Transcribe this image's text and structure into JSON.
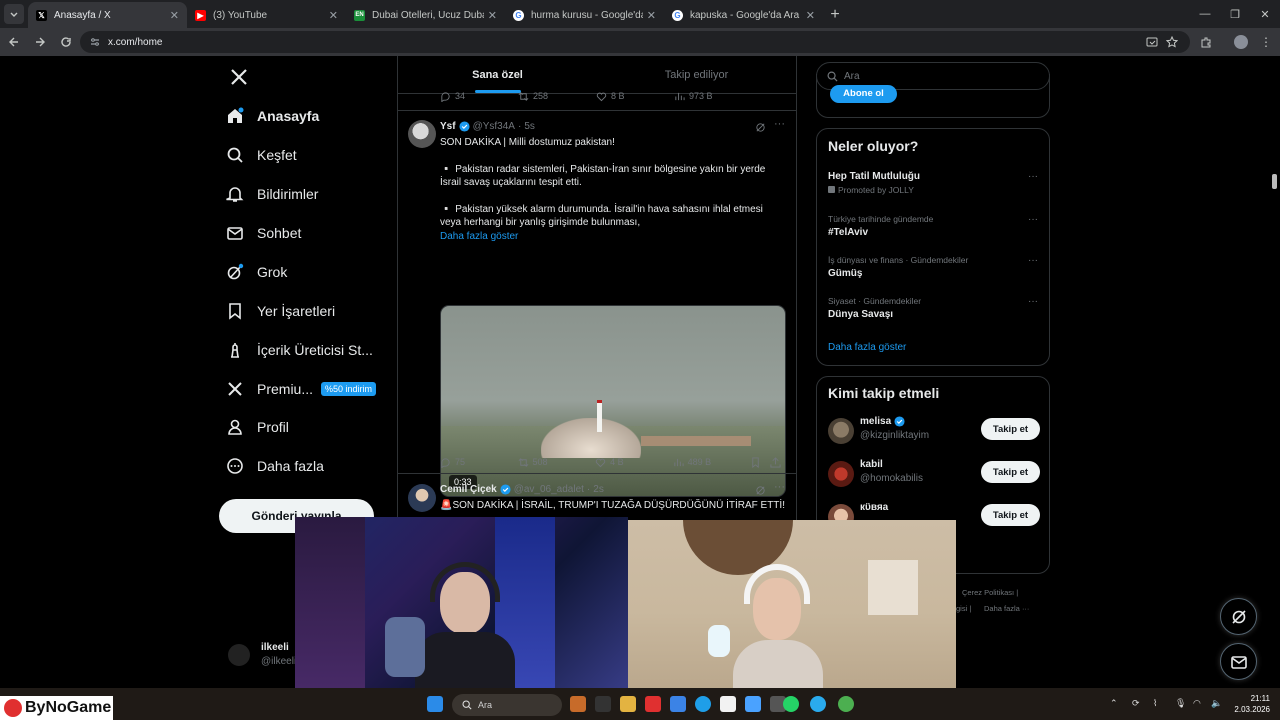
{
  "browser": {
    "tabs": [
      {
        "title": "Anasayfa / X",
        "favicon": "x-logo",
        "active": true
      },
      {
        "title": "(3) YouTube",
        "favicon": "youtube-logo",
        "active": false
      },
      {
        "title": "Dubai Otelleri, Ucuz Dubai Otel",
        "favicon": "hotel-logo",
        "active": false
      },
      {
        "title": "hurma kurusu - Google'da Ara",
        "favicon": "google-logo",
        "active": false
      },
      {
        "title": "kapuska - Google'da Ara",
        "favicon": "google-logo",
        "active": false
      }
    ],
    "url": "x.com/home"
  },
  "nav": {
    "items": [
      {
        "label": "Anasayfa",
        "icon": "home-icon"
      },
      {
        "label": "Keşfet",
        "icon": "search-icon"
      },
      {
        "label": "Bildirimler",
        "icon": "bell-icon"
      },
      {
        "label": "Sohbet",
        "icon": "mail-icon"
      },
      {
        "label": "Grok",
        "icon": "grok-icon"
      },
      {
        "label": "Yer İşaretleri",
        "icon": "bookmark-icon"
      },
      {
        "label": "İçerik Üreticisi St...",
        "icon": "creator-icon"
      },
      {
        "label": "Premiu...",
        "icon": "x-icon"
      },
      {
        "label": "Profil",
        "icon": "person-icon"
      },
      {
        "label": "Daha fazla",
        "icon": "more-circle-icon"
      }
    ],
    "premium_badge": "%50 indirim",
    "post_button": "Gönderi yayınla",
    "account": {
      "name": "ilkeeli",
      "handle": "@ilkeeli"
    }
  },
  "feed": {
    "tabs": [
      "Sana özel",
      "Takip ediliyor"
    ],
    "prev_actions": {
      "replies": "34",
      "reposts": "258",
      "likes": "8 B",
      "views": "973 B"
    },
    "tweet1": {
      "name": "Ysf",
      "handle": "@Ysf34A",
      "time": "5s",
      "headline": "SON DAKİKA | Milli dostumuz pakistan!",
      "bullet1": "Pakistan radar sistemleri, Pakistan-İran sınır bölgesine yakın bir yerde İsrail savaş uçaklarını tespit etti.",
      "bullet2": "Pakistan yüksek alarm durumunda. İsrail'in hava sahasını ihlal etmesi veya herhangi bir yanlış girişimde bulunması,",
      "show_more": "Daha fazla göster",
      "video_duration": "0:33",
      "replies": "75",
      "reposts": "508",
      "likes": "4 B",
      "views": "489 B"
    },
    "tweet2": {
      "name": "Cemil Çiçek",
      "handle": "@av_06_adalet",
      "time": "2s",
      "text": "🚨SON DAKİKA | İSRAİL, TRUMP'I TUZAĞA DÜŞÜRDÜĞÜNÜ İTİRAF ETTİ!"
    }
  },
  "sidebar": {
    "search_placeholder": "Ara",
    "subscribe_button": "Abone ol",
    "trends_title": "Neler oluyor?",
    "trends": [
      {
        "context": "",
        "name": "Hep Tatil Mutluluğu",
        "promo": "Promoted by JOLLY"
      },
      {
        "context": "Türkiye tarihinde gündemde",
        "name": "#TelAviv"
      },
      {
        "context": "İş dünyası ve finans · Gündemdekiler",
        "name": "Gümüş"
      },
      {
        "context": "Siyaset · Gündemdekiler",
        "name": "Dünya Savaşı"
      }
    ],
    "show_more": "Daha fazla göster",
    "wtf_title": "Kimi takip etmeli",
    "wtf": [
      {
        "name": "melisa",
        "handle": "@kizginliktayim",
        "verified": true,
        "button": "Takip et"
      },
      {
        "name": "kabil",
        "handle": "@homokabilis",
        "verified": false,
        "button": "Takip et"
      },
      {
        "name": "кϋвяа",
        "handle": "",
        "verified": false,
        "button": "Takip et"
      }
    ],
    "footer1": "Çerez Politikası",
    "footer2": "Daha fazla ···",
    "footer3": "gisi"
  },
  "taskbar": {
    "brand": "ByNoGame",
    "search": "Ara",
    "time": "21:11",
    "date": "2.03.2026"
  },
  "colors": {
    "accent": "#1d9bf0",
    "bg": "#000000",
    "border": "#2f3336",
    "muted": "#71767b"
  }
}
